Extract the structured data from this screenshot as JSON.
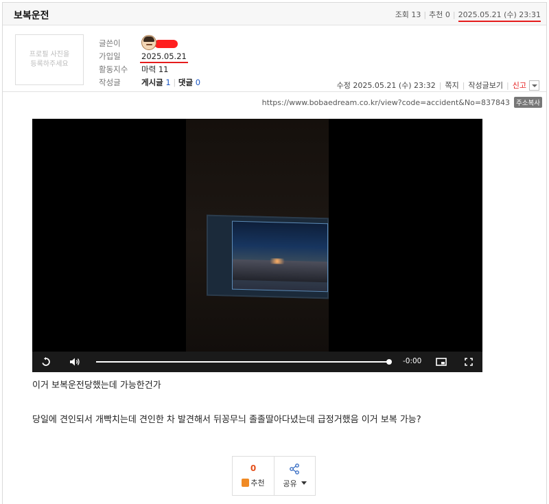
{
  "post": {
    "title": "보복운전",
    "views_label": "조회 13",
    "recommend_label": "추천 0",
    "datetime": "2025.05.21 (수) 23:31"
  },
  "profile": {
    "photo_placeholder": "프로필 사진을\n등록하주세요",
    "labels": {
      "author": "글쓴이",
      "joined": "가입일",
      "activity": "활동지수",
      "posts": "작성글"
    },
    "joined_date": "2025.05.21",
    "activity_value": "마력 11",
    "posts_label": "게시글",
    "posts_count": "1",
    "comments_label": "댓글",
    "comments_count": "0"
  },
  "actions": {
    "edited": "수정 2025.05.21 (수) 23:32",
    "message": "쪽지",
    "view_posts": "작성글보기",
    "report": "신고"
  },
  "url": {
    "text": "https://www.bobaedream.co.kr/view?code=accident&No=837843",
    "copy_label": "주소복사"
  },
  "video": {
    "time": "-0:00",
    "progress": 1.0
  },
  "content": {
    "line1": "이거 보복운전당했는데 가능한건가",
    "line2": "당일에 견인되서 개빡치는데 견인한 차 발견해서 뒤꽁무늬 졸졸딸아다녔는데 급정거했음 이거 보복 가능?"
  },
  "reactions": {
    "recommend_count": "0",
    "recommend_label": "추천",
    "share_label": "공유"
  },
  "colors": {
    "accent_red": "#e51b1b",
    "link_blue": "#1a56c4",
    "recommend_orange": "#e5501b"
  }
}
